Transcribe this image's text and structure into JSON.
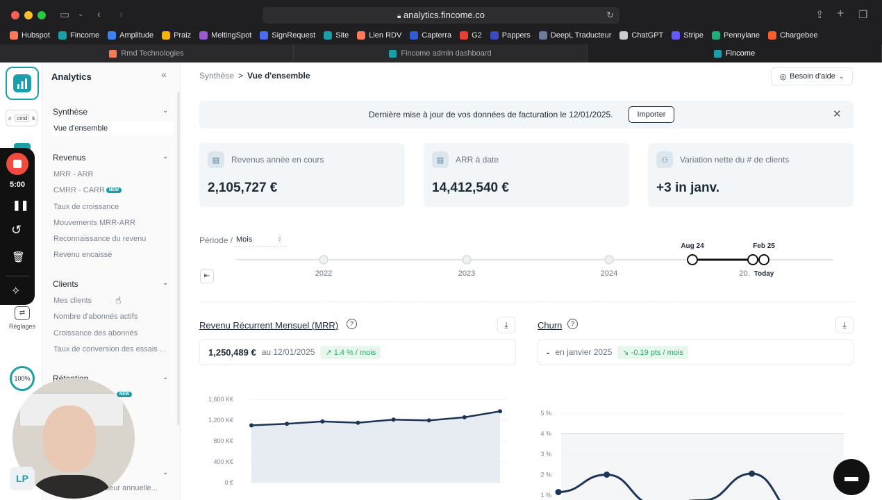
{
  "browser": {
    "url": "analytics.fincome.co",
    "bookmarks": [
      {
        "label": "Hubspot",
        "color": "#ff7a59"
      },
      {
        "label": "Fincome",
        "color": "#1a9fa8"
      },
      {
        "label": "Amplitude",
        "color": "#3b82f6"
      },
      {
        "label": "Praiz",
        "color": "#f5b400"
      },
      {
        "label": "MeltingSpot",
        "color": "#9b59d0"
      },
      {
        "label": "SignRequest",
        "color": "#4a6cf7"
      },
      {
        "label": "Site",
        "color": "#1a9fa8"
      },
      {
        "label": "Lien RDV",
        "color": "#ff7a59"
      },
      {
        "label": "Capterra",
        "color": "#2f5cd6"
      },
      {
        "label": "G2",
        "color": "#e8412f"
      },
      {
        "label": "Pappers",
        "color": "#3a4bbf"
      },
      {
        "label": "DeepL Traducteur",
        "color": "#6d7b9a"
      },
      {
        "label": "ChatGPT",
        "color": "#cccccc"
      },
      {
        "label": "Stripe",
        "color": "#635bff"
      },
      {
        "label": "Pennylane",
        "color": "#1fae7a"
      },
      {
        "label": "Chargebee",
        "color": "#ff5c2b"
      }
    ],
    "tabs": [
      {
        "label": "Rmd Technologies",
        "color": "#ff7a59"
      },
      {
        "label": "Fincome admin dashboard",
        "color": "#1a9fa8"
      },
      {
        "label": "Fincome",
        "color": "#1a9fa8"
      }
    ]
  },
  "rail": {
    "cmdk": [
      "cmd",
      "k"
    ],
    "timer": "5:00",
    "settings_label": "Réglages",
    "progress": "100%",
    "avatar": "LP"
  },
  "sidebar": {
    "title": "Analytics",
    "sections": [
      {
        "title": "Synthèse",
        "items": [
          "Vue d'ensemble"
        ]
      },
      {
        "title": "Revenus",
        "items": [
          "MRR - ARR",
          "CMRR - CARR",
          "Taux de croissance",
          "Mouvements MRR-ARR",
          "Reconnaissance du revenu",
          "Revenu encaissé"
        ]
      },
      {
        "title": "Clients",
        "items": [
          "Mes clients",
          "Nombre d'abonnés actifs",
          "Croissance des abonnés",
          "Taux de conversion des essais ..."
        ]
      },
      {
        "title": "Rétention",
        "items": []
      }
    ],
    "new_badge": "NEW",
    "bottom_item": "Valeur annuelle..."
  },
  "header": {
    "crumb_parent": "Synthèse",
    "crumb_sep": ">",
    "crumb_current": "Vue d'ensemble",
    "help": "Besoin d'aide"
  },
  "banner": {
    "text": "Dernière mise à jour de vos données de facturation le 12/01/2025.",
    "button": "Importer"
  },
  "kpis": [
    {
      "label": "Revenus année en cours",
      "value": "2,105,727 €"
    },
    {
      "label": "ARR à date",
      "value": "14,412,540 €"
    },
    {
      "label": "Variation nette du # de clients",
      "value": "+3 in janv."
    }
  ],
  "period": {
    "label": "Période /",
    "value": "Mois",
    "years": [
      "2022",
      "2023",
      "2024",
      "20."
    ],
    "range_start": "Aug 24",
    "range_end": "Feb 25",
    "today": "Today"
  },
  "mrr": {
    "title": "Revenu Récurrent Mensuel (MRR)",
    "value": "1,250,489 €",
    "date": "au 12/01/2025",
    "delta": "1.4 % / mois",
    "chart_data": {
      "type": "area",
      "yticks": [
        "1,600 K€",
        "1,200 K€",
        "800 K€",
        "400 K€",
        "0 €"
      ],
      "ylim": [
        0,
        1600
      ],
      "values": [
        1100,
        1130,
        1175,
        1150,
        1210,
        1195,
        1255,
        1370
      ]
    }
  },
  "churn": {
    "title": "Churn",
    "value": "-",
    "date": "en janvier 2025",
    "delta": "-0.19 pts / mois",
    "chart_data": {
      "type": "line",
      "yticks": [
        "5 %",
        "4 %",
        "3 %",
        "2 %",
        "1 %"
      ],
      "ylim": [
        0,
        5
      ],
      "values": [
        1.15,
        2.0,
        0.55,
        0.75,
        2.05,
        0.0,
        0.0
      ]
    }
  }
}
